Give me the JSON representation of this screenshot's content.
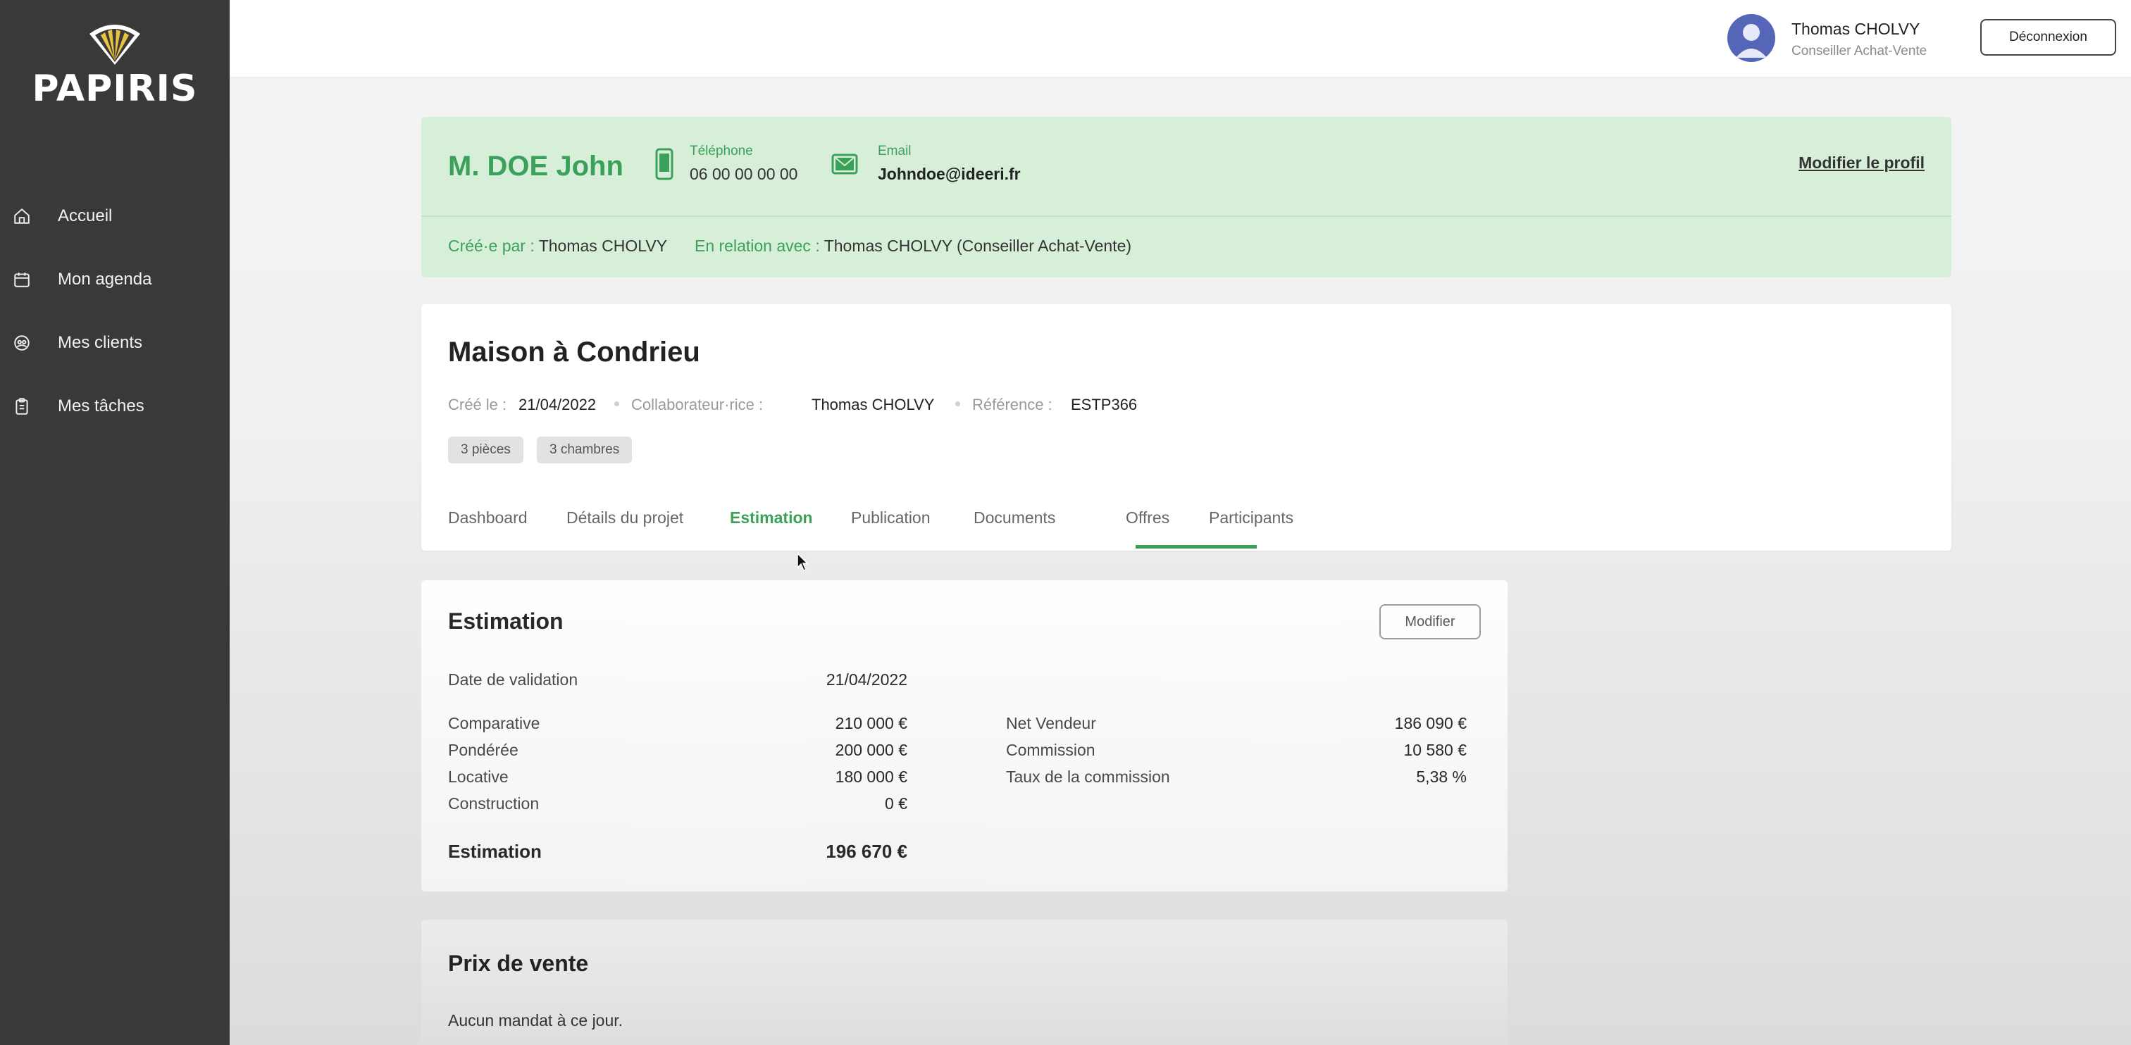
{
  "app": {
    "logo_text": "PAPIRIS"
  },
  "sidebar": {
    "items": [
      {
        "label": "Accueil",
        "icon": "home-icon"
      },
      {
        "label": "Mon agenda",
        "icon": "calendar-icon"
      },
      {
        "label": "Mes clients",
        "icon": "clients-icon"
      },
      {
        "label": "Mes tâches",
        "icon": "clipboard-icon"
      }
    ]
  },
  "topbar": {
    "user_name": "Thomas CHOLVY",
    "user_role": "Conseiller Achat-Vente",
    "logout_label": "Déconnexion"
  },
  "client": {
    "name": "M. DOE John",
    "phone_label": "Téléphone",
    "phone": "06 00 00 00 00",
    "email_label": "Email",
    "email": "Johndoe@ideeri.fr",
    "edit_label": "Modifier le profil",
    "created_by_label": "Créé·e par :",
    "created_by": "Thomas CHOLVY",
    "relation_label": "En relation avec :",
    "relation": "Thomas CHOLVY (Conseiller Achat-Vente)"
  },
  "project": {
    "title": "Maison à Condrieu",
    "created_label": "Créé le :",
    "created": "21/04/2022",
    "collab_label": "Collaborateur·rice :",
    "collab": "Thomas CHOLVY",
    "ref_label": "Référence :",
    "ref": "ESTP366",
    "tags": [
      "3 pièces",
      "3 chambres"
    ],
    "tabs": [
      "Dashboard",
      "Détails du projet",
      "Estimation",
      "Publication",
      "Documents",
      "Offres",
      "Participants"
    ],
    "active_tab": "Estimation"
  },
  "estimation": {
    "title": "Estimation",
    "modify_label": "Modifier",
    "validation_label": "Date de validation",
    "validation_date": "21/04/2022",
    "left_rows": [
      {
        "label": "Comparative",
        "value": "210 000 €"
      },
      {
        "label": "Pondérée",
        "value": "200 000 €"
      },
      {
        "label": "Locative",
        "value": "180 000 €"
      },
      {
        "label": "Construction",
        "value": "0 €"
      }
    ],
    "right_rows": [
      {
        "label": "Net Vendeur",
        "value": "186 090 €"
      },
      {
        "label": "Commission",
        "value": "10 580 €"
      },
      {
        "label": "Taux de la commission",
        "value": "5,38 %"
      }
    ],
    "total_label": "Estimation",
    "total_value": "196 670 €"
  },
  "price": {
    "title": "Prix de vente",
    "empty": "Aucun mandat à ce jour."
  },
  "colors": {
    "sidebar": "#3b3838",
    "accent": "#3aa05a",
    "client_bg": "#d7efd9"
  }
}
